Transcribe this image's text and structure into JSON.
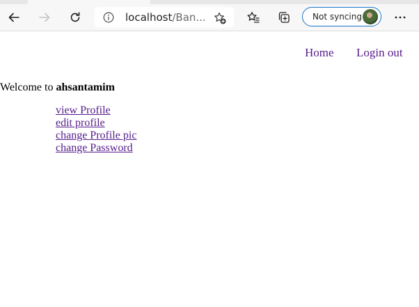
{
  "browser": {
    "address": {
      "host": "localhost",
      "path_truncated": "/Ban..."
    },
    "sync_button_label": "Not syncing",
    "icons": {
      "back": "arrow-left-icon",
      "forward": "arrow-right-icon",
      "refresh": "refresh-icon",
      "site_info": "info-icon",
      "add_favorite": "star-plus-icon",
      "favorites": "favorites-icon",
      "collections": "collections-icon",
      "profile": "avatar",
      "more": "more-icon"
    }
  },
  "page": {
    "nav": {
      "home": "Home",
      "logout": "Login out"
    },
    "welcome_prefix": "Welcome to",
    "username": "ahsantamim",
    "menu": [
      {
        "label": "view Profile"
      },
      {
        "label": "edit profile"
      },
      {
        "label": "change Profile pic"
      },
      {
        "label": "change Password"
      }
    ],
    "link_color": "#551a8b"
  }
}
